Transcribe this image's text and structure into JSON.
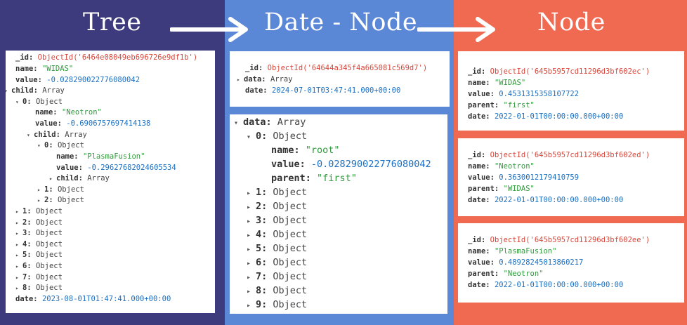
{
  "titles": {
    "tree": "Tree",
    "date_node": "Date - Node",
    "node": "Node"
  },
  "tree_doc": {
    "id_label": "_id:",
    "id_value": "ObjectId('6464e08049eb696726e9df1b')",
    "name_label": "name:",
    "name_value": "\"WIDAS\"",
    "value_label": "value:",
    "value_value": "-0.028290022776080042",
    "child_label": "child:",
    "child_type": "Array",
    "c0_label": "0:",
    "c0_type": "Object",
    "c0_name_label": "name:",
    "c0_name_value": "\"Neotron\"",
    "c0_value_label": "value:",
    "c0_value_value": "-0.6906757697414138",
    "c0_child_label": "child:",
    "c0_child_type": "Array",
    "c00_label": "0:",
    "c00_type": "Object",
    "c00_name_label": "name:",
    "c00_name_value": "\"PlasmaFusion\"",
    "c00_value_label": "value:",
    "c00_value_value": "-0.29627682024605534",
    "c00_child_label": "child:",
    "c00_child_type": "Array",
    "c01_label": "1:",
    "c01_type": "Object",
    "c02_label": "2:",
    "c02_type": "Object",
    "items": [
      {
        "label": "1:",
        "type": "Object"
      },
      {
        "label": "2:",
        "type": "Object"
      },
      {
        "label": "3:",
        "type": "Object"
      },
      {
        "label": "4:",
        "type": "Object"
      },
      {
        "label": "5:",
        "type": "Object"
      },
      {
        "label": "6:",
        "type": "Object"
      },
      {
        "label": "7:",
        "type": "Object"
      },
      {
        "label": "8:",
        "type": "Object"
      }
    ],
    "date_label": "date:",
    "date_value": "2023-08-01T01:47:41.000+00:00"
  },
  "date_doc": {
    "id_label": "_id:",
    "id_value": "ObjectId('64644a345f4a665081c569d7')",
    "data_label": "data:",
    "data_type": "Array",
    "date_label": "date:",
    "date_value": "2024-07-01T03:47:41.000+00:00"
  },
  "date_expanded": {
    "data_label": "data:",
    "data_type": "Array",
    "i0_label": "0:",
    "i0_type": "Object",
    "i0_name_label": "name:",
    "i0_name_value": "\"root\"",
    "i0_value_label": "value:",
    "i0_value_value": "-0.028290022776080042",
    "i0_parent_label": "parent:",
    "i0_parent_value": "\"first\"",
    "items": [
      {
        "label": "1:",
        "type": "Object"
      },
      {
        "label": "2:",
        "type": "Object"
      },
      {
        "label": "3:",
        "type": "Object"
      },
      {
        "label": "4:",
        "type": "Object"
      },
      {
        "label": "5:",
        "type": "Object"
      },
      {
        "label": "6:",
        "type": "Object"
      },
      {
        "label": "7:",
        "type": "Object"
      },
      {
        "label": "8:",
        "type": "Object"
      },
      {
        "label": "9:",
        "type": "Object"
      }
    ]
  },
  "node_docs": [
    {
      "id_label": "_id:",
      "id_value": "ObjectId('645b5957cd11296d3bf602ec')",
      "name_label": "name:",
      "name_value": "\"WIDAS\"",
      "value_label": "value:",
      "value_value": "0.4531315358107722",
      "parent_label": "parent:",
      "parent_value": "\"first\"",
      "date_label": "date:",
      "date_value": "2022-01-01T00:00:00.000+00:00"
    },
    {
      "id_label": "_id:",
      "id_value": "ObjectId('645b5957cd11296d3bf602ed')",
      "name_label": "name:",
      "name_value": "\"Neotron\"",
      "value_label": "value:",
      "value_value": "0.3630012179410759",
      "parent_label": "parent:",
      "parent_value": "\"WIDAS\"",
      "date_label": "date:",
      "date_value": "2022-01-01T00:00:00.000+00:00"
    },
    {
      "id_label": "_id:",
      "id_value": "ObjectId('645b5957cd11296d3bf602ee')",
      "name_label": "name:",
      "name_value": "\"PlasmaFusion\"",
      "value_label": "value:",
      "value_value": "0.48928245013860217",
      "parent_label": "parent:",
      "parent_value": "\"Neotron\"",
      "date_label": "date:",
      "date_value": "2022-01-01T00:00:00.000+00:00"
    }
  ]
}
